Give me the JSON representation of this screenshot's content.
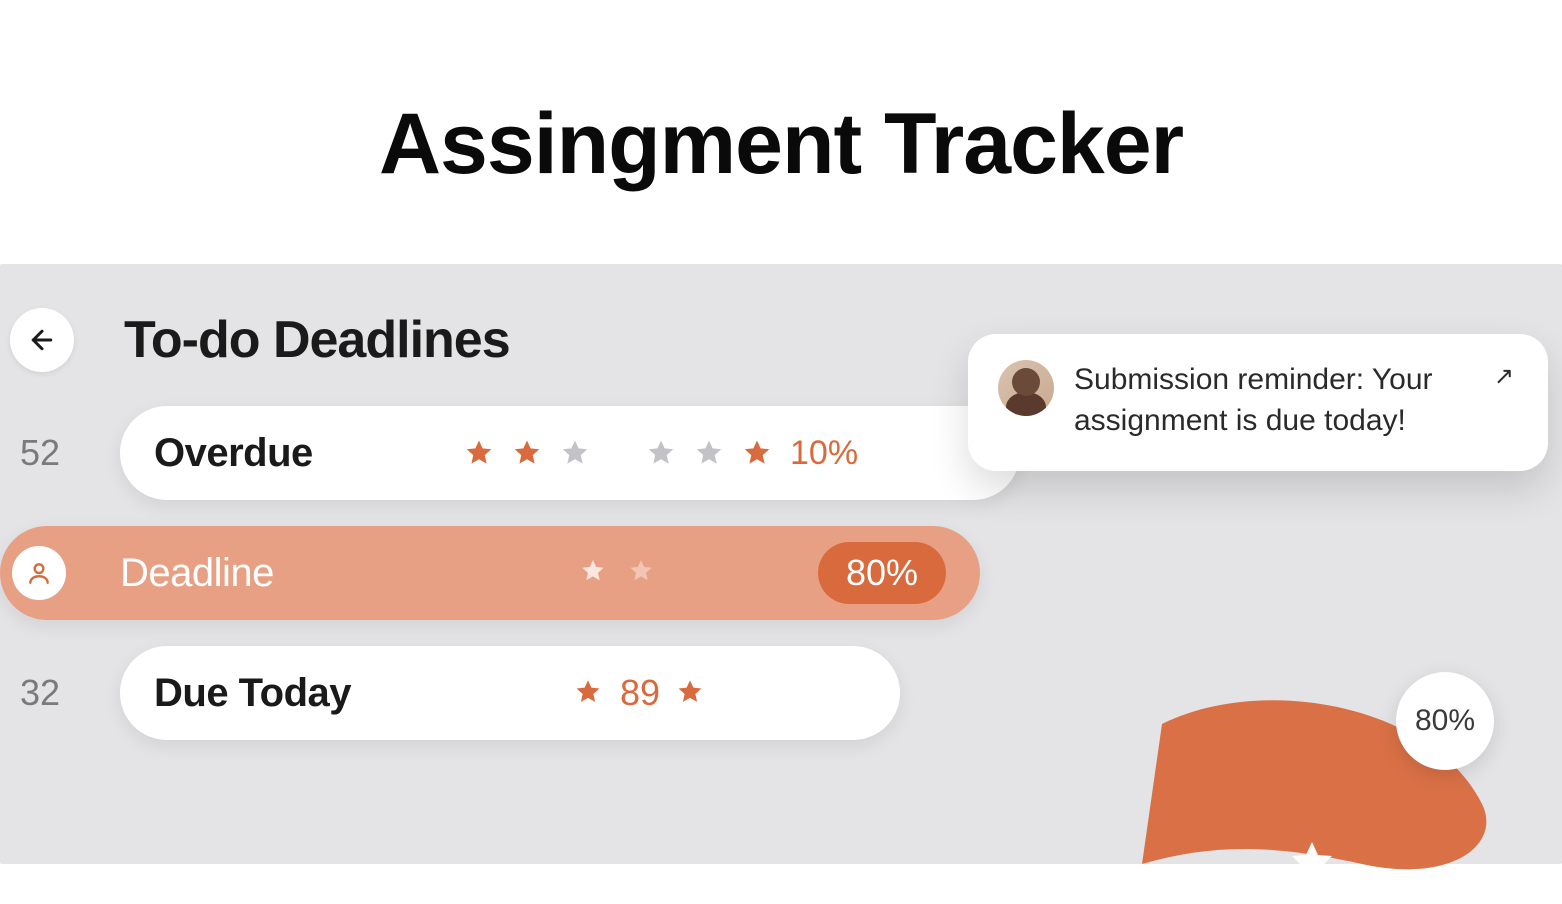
{
  "page_title": "Assingment Tracker",
  "section_title": "To-do Deadlines",
  "colors": {
    "accent": "#d96a3d",
    "accent_soft": "#e8a084",
    "muted": "#b9b9bd"
  },
  "rows": [
    {
      "count": "52",
      "label": "Overdue",
      "selected": false,
      "stars": [
        {
          "fill": "accent"
        },
        {
          "fill": "accent"
        },
        {
          "fill": "muted"
        },
        {
          "fill": "gap"
        },
        {
          "fill": "muted"
        },
        {
          "fill": "muted"
        },
        {
          "fill": "accent"
        }
      ],
      "percent_text": "10%"
    },
    {
      "count": "",
      "label": "Deadline",
      "selected": true,
      "lead_icon": "person-icon",
      "stars": [
        {
          "fill": "white60"
        },
        {
          "fill": "white30"
        }
      ],
      "percent_pill": "80%"
    },
    {
      "count": "32",
      "label": "Due Today",
      "selected": false,
      "mid_star_left": true,
      "mid_value": "89",
      "mid_star_right": true
    }
  ],
  "swoosh_badge": "80%",
  "toast": {
    "text": "Submission reminder: Your assignment is due today!",
    "expand_glyph": "↗"
  }
}
